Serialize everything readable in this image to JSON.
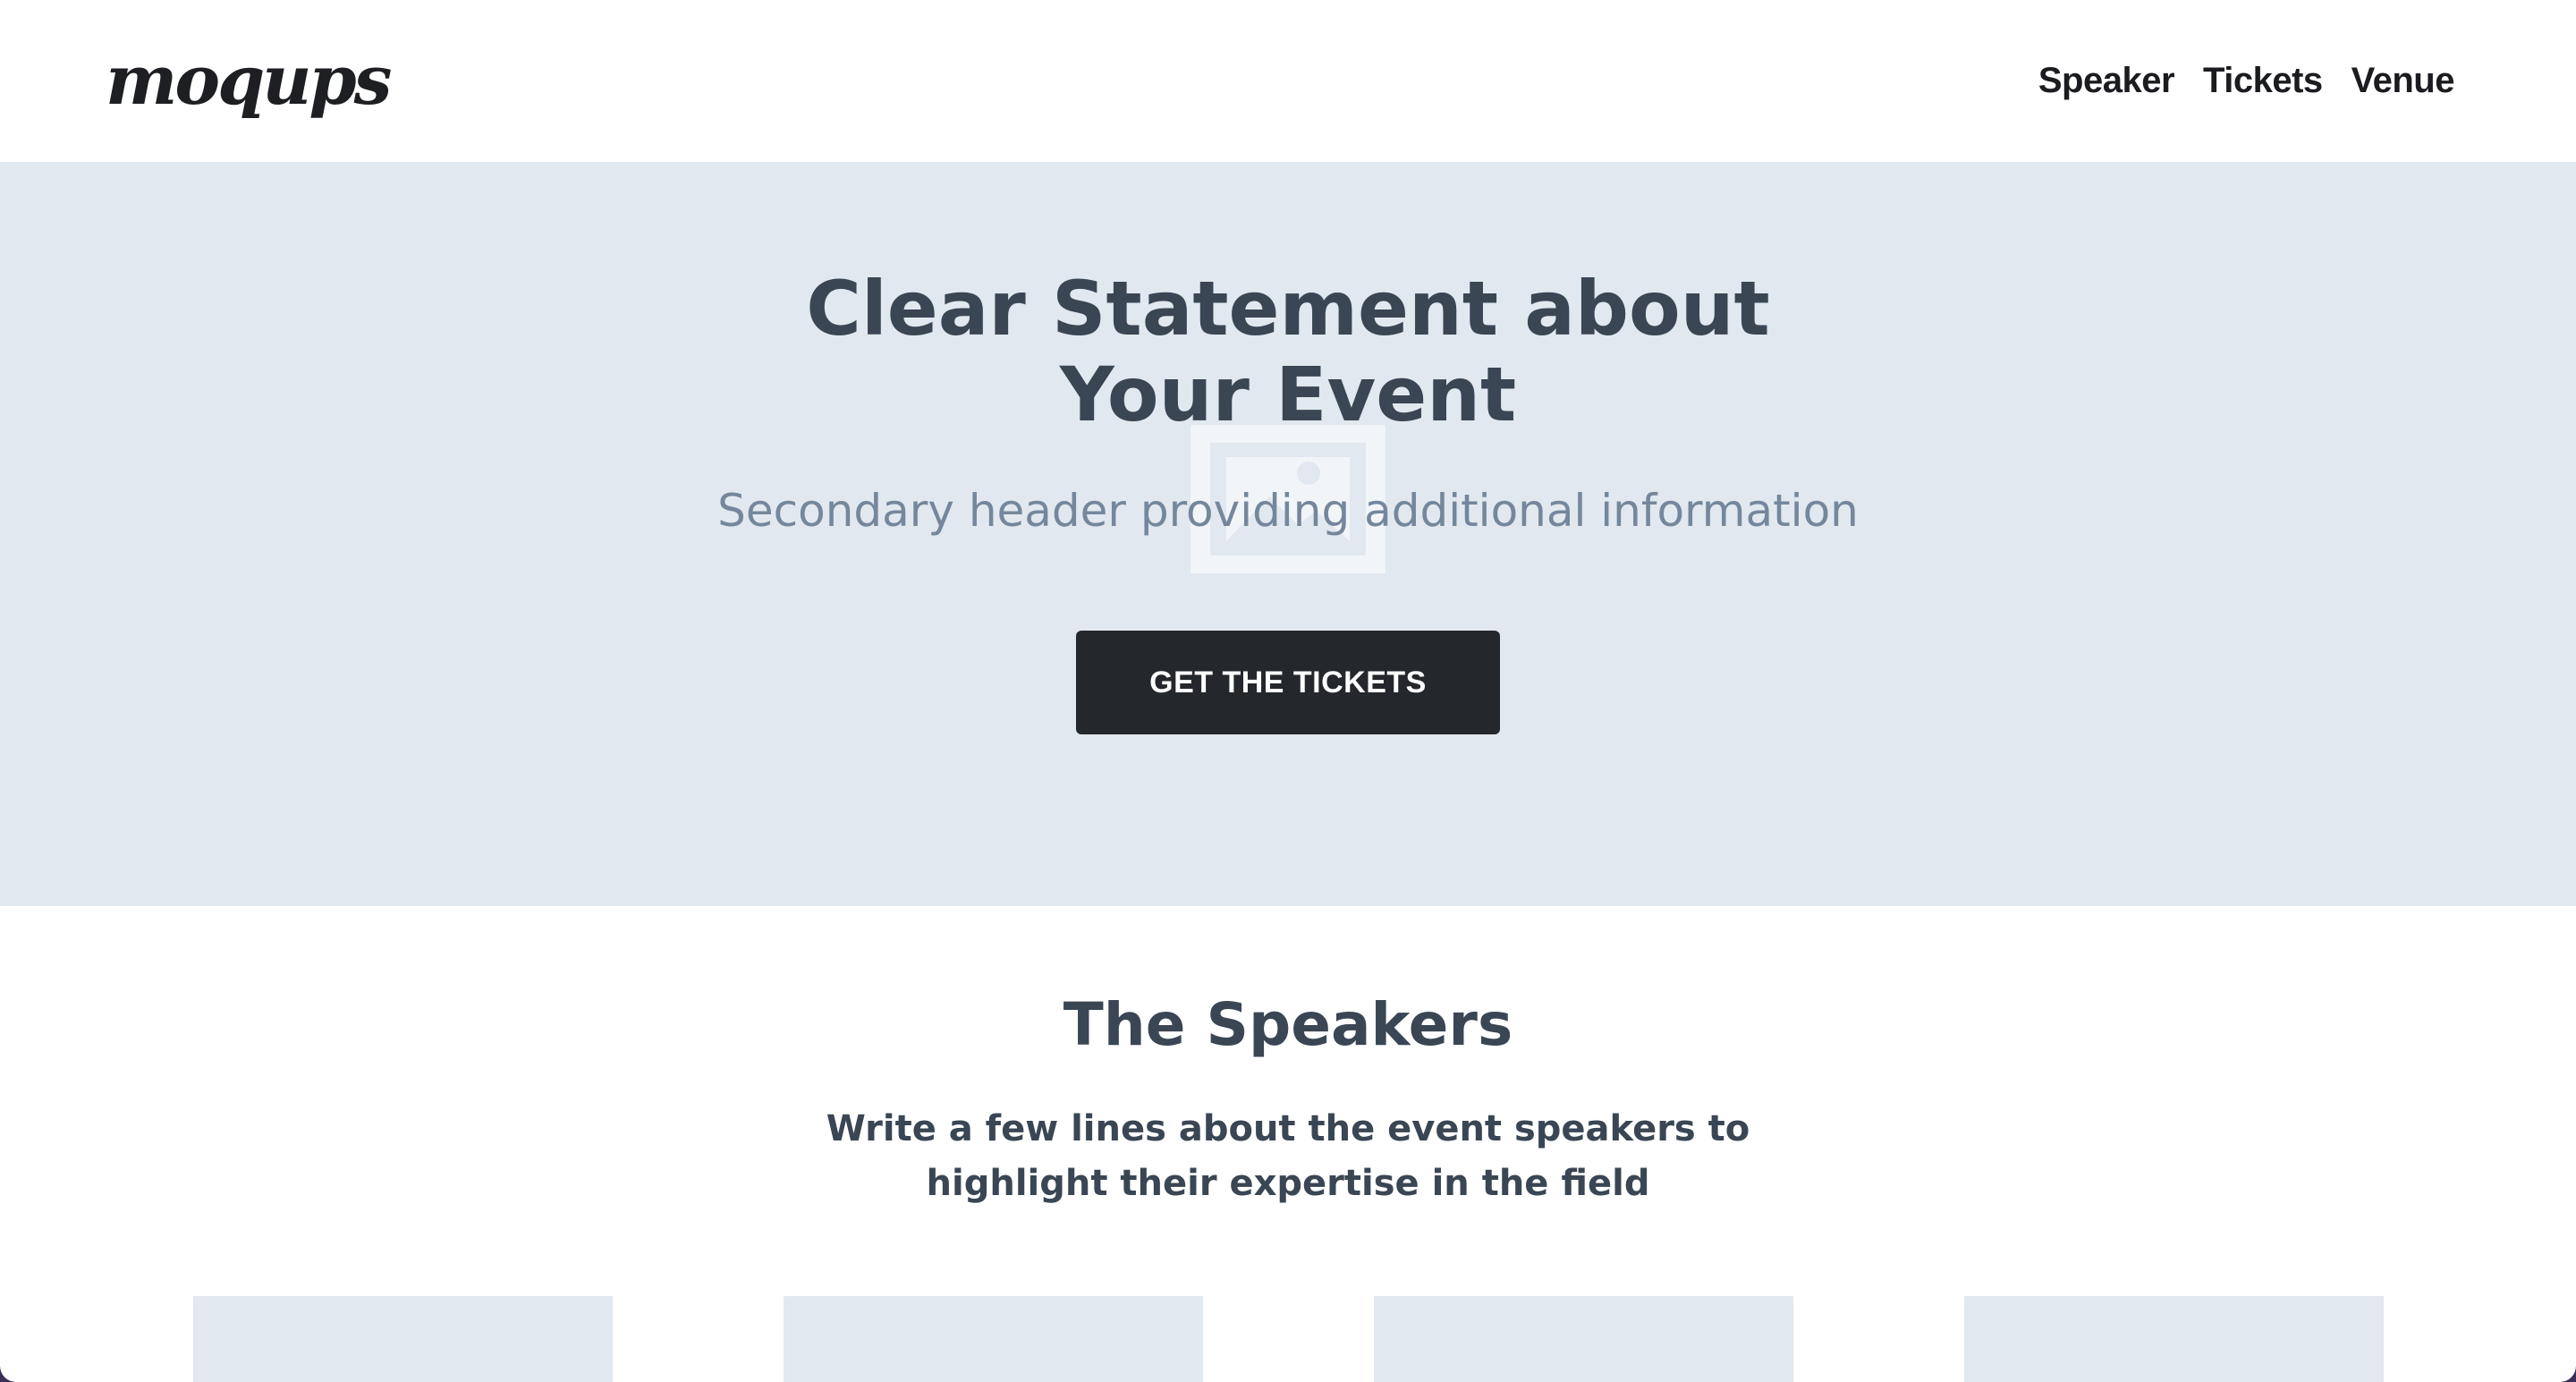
{
  "header": {
    "logo": "moqups",
    "nav": [
      {
        "label": "Speaker"
      },
      {
        "label": "Tickets"
      },
      {
        "label": "Venue"
      }
    ]
  },
  "hero": {
    "title_line1": "Clear Statement about",
    "title_line2": "Your Event",
    "subtitle": "Secondary header providing additional information",
    "cta_label": "GET THE TICKETS",
    "image_icon": "image-placeholder-icon"
  },
  "speakers": {
    "title": "The Speakers",
    "desc_line1": "Write a few lines about the event speakers to",
    "desc_line2": "highlight their expertise in the field",
    "card_count": 4
  },
  "colors": {
    "hero_bg": "#e1e8ef",
    "heading": "#3a4654",
    "subheading": "#74879c",
    "cta_bg": "#24272b"
  }
}
